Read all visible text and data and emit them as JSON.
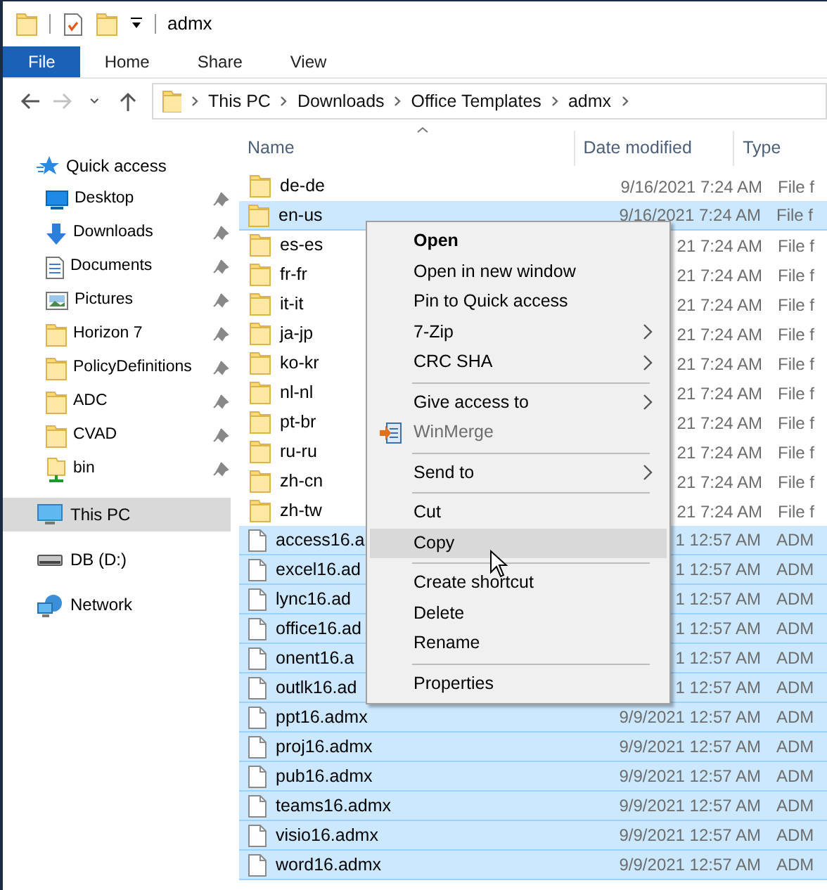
{
  "window": {
    "title": "admx"
  },
  "ribbon_tabs": [
    {
      "label": "File",
      "selected": true
    },
    {
      "label": "Home",
      "selected": false
    },
    {
      "label": "Share",
      "selected": false
    },
    {
      "label": "View",
      "selected": false
    }
  ],
  "navigation": [
    {
      "kind": "back",
      "disabled": false
    },
    {
      "kind": "forward",
      "disabled": true
    },
    {
      "kind": "recent",
      "disabled": false
    },
    {
      "kind": "up",
      "disabled": false
    }
  ],
  "address_bar": {
    "segments": [
      "This PC",
      "Downloads",
      "Office Templates",
      "admx"
    ]
  },
  "sidebar": {
    "items": [
      {
        "label": "Quick access",
        "kind": "star",
        "selected": false,
        "children": [
          {
            "label": "Desktop",
            "kind": "desktop",
            "pinned": true,
            "selected": false
          },
          {
            "label": "Downloads",
            "kind": "download",
            "pinned": true,
            "selected": false
          },
          {
            "label": "Documents",
            "kind": "document",
            "pinned": true,
            "selected": false
          },
          {
            "label": "Pictures",
            "kind": "pictures",
            "pinned": true,
            "selected": false
          },
          {
            "label": "Horizon 7",
            "kind": "folder",
            "pinned": true,
            "selected": false
          },
          {
            "label": "PolicyDefinitions",
            "kind": "folder",
            "pinned": true,
            "selected": false
          },
          {
            "label": "ADC",
            "kind": "folder",
            "pinned": true,
            "selected": false
          },
          {
            "label": "CVAD",
            "kind": "folder",
            "pinned": true,
            "selected": false
          },
          {
            "label": "bin",
            "kind": "share-folder",
            "pinned": true,
            "selected": false
          }
        ]
      },
      {
        "label": "This PC",
        "kind": "computer",
        "selected": true
      },
      {
        "label": "DB (D:)",
        "kind": "drive",
        "selected": false
      },
      {
        "label": "Network",
        "kind": "network",
        "selected": false
      }
    ]
  },
  "columns": [
    {
      "label": "Name",
      "sorted": true
    },
    {
      "label": "Date modified",
      "sorted": false
    },
    {
      "label": "Type",
      "sorted": false
    }
  ],
  "rows": [
    {
      "name": "de-de",
      "date": "9/16/2021 7:24 AM",
      "type": "File f",
      "kind": "folder",
      "selected": false
    },
    {
      "name": "en-us",
      "date": "9/16/2021 7:24 AM",
      "type": "File f",
      "kind": "folder",
      "selected": true
    },
    {
      "name": "es-es",
      "date": "21 7:24 AM",
      "type": "File f",
      "kind": "folder",
      "selected": false
    },
    {
      "name": "fr-fr",
      "date": "21 7:24 AM",
      "type": "File f",
      "kind": "folder",
      "selected": false
    },
    {
      "name": "it-it",
      "date": "21 7:24 AM",
      "type": "File f",
      "kind": "folder",
      "selected": false
    },
    {
      "name": "ja-jp",
      "date": "21 7:24 AM",
      "type": "File f",
      "kind": "folder",
      "selected": false
    },
    {
      "name": "ko-kr",
      "date": "21 7:24 AM",
      "type": "File f",
      "kind": "folder",
      "selected": false
    },
    {
      "name": "nl-nl",
      "date": "21 7:24 AM",
      "type": "File f",
      "kind": "folder",
      "selected": false
    },
    {
      "name": "pt-br",
      "date": "21 7:24 AM",
      "type": "File f",
      "kind": "folder",
      "selected": false
    },
    {
      "name": "ru-ru",
      "date": "21 7:24 AM",
      "type": "File f",
      "kind": "folder",
      "selected": false
    },
    {
      "name": "zh-cn",
      "date": "21 7:24 AM",
      "type": "File f",
      "kind": "folder",
      "selected": false
    },
    {
      "name": "zh-tw",
      "date": "21 7:24 AM",
      "type": "File f",
      "kind": "folder",
      "selected": false
    },
    {
      "name": "access16.a",
      "date": "1 12:57 AM",
      "type": "ADM",
      "kind": "file",
      "selected": true
    },
    {
      "name": "excel16.ad",
      "date": "1 12:57 AM",
      "type": "ADM",
      "kind": "file",
      "selected": true
    },
    {
      "name": "lync16.ad",
      "date": "1 12:57 AM",
      "type": "ADM",
      "kind": "file",
      "selected": true
    },
    {
      "name": "office16.ad",
      "date": "1 12:57 AM",
      "type": "ADM",
      "kind": "file",
      "selected": true
    },
    {
      "name": "onent16.a",
      "date": "1 12:57 AM",
      "type": "ADM",
      "kind": "file",
      "selected": true
    },
    {
      "name": "outlk16.ad",
      "date": "1 12:57 AM",
      "type": "ADM",
      "kind": "file",
      "selected": true
    },
    {
      "name": "ppt16.admx",
      "date": "9/9/2021 12:57 AM",
      "type": "ADM",
      "kind": "file",
      "selected": true
    },
    {
      "name": "proj16.admx",
      "date": "9/9/2021 12:57 AM",
      "type": "ADM",
      "kind": "file",
      "selected": true
    },
    {
      "name": "pub16.admx",
      "date": "9/9/2021 12:57 AM",
      "type": "ADM",
      "kind": "file",
      "selected": true
    },
    {
      "name": "teams16.admx",
      "date": "9/9/2021 12:57 AM",
      "type": "ADM",
      "kind": "file",
      "selected": true
    },
    {
      "name": "visio16.admx",
      "date": "9/9/2021 12:57 AM",
      "type": "ADM",
      "kind": "file",
      "selected": true
    },
    {
      "name": "word16.admx",
      "date": "9/9/2021 12:57 AM",
      "type": "ADM",
      "kind": "file",
      "selected": true
    }
  ],
  "context_menu": {
    "items": [
      {
        "kind": "item",
        "label": "Open",
        "bold": true,
        "submenu": false,
        "disabled": false,
        "selected": false
      },
      {
        "kind": "item",
        "label": "Open in new window",
        "bold": false,
        "submenu": false,
        "disabled": false,
        "selected": false
      },
      {
        "kind": "item",
        "label": "Pin to Quick access",
        "bold": false,
        "submenu": false,
        "disabled": false,
        "selected": false
      },
      {
        "kind": "item",
        "label": "7-Zip",
        "bold": false,
        "submenu": true,
        "disabled": false,
        "selected": false
      },
      {
        "kind": "item",
        "label": "CRC SHA",
        "bold": false,
        "submenu": true,
        "disabled": false,
        "selected": false
      },
      {
        "kind": "separator"
      },
      {
        "kind": "item",
        "label": "Give access to",
        "bold": false,
        "submenu": true,
        "disabled": false,
        "selected": false
      },
      {
        "kind": "item",
        "label": "WinMerge",
        "bold": false,
        "submenu": false,
        "disabled": true,
        "selected": false,
        "icon": true
      },
      {
        "kind": "separator"
      },
      {
        "kind": "item",
        "label": "Send to",
        "bold": false,
        "submenu": true,
        "disabled": false,
        "selected": false
      },
      {
        "kind": "separator"
      },
      {
        "kind": "item",
        "label": "Cut",
        "bold": false,
        "submenu": false,
        "disabled": false,
        "selected": false
      },
      {
        "kind": "item",
        "label": "Copy",
        "bold": false,
        "submenu": false,
        "disabled": false,
        "selected": true
      },
      {
        "kind": "separator"
      },
      {
        "kind": "item",
        "label": "Create shortcut",
        "bold": false,
        "submenu": false,
        "disabled": false,
        "selected": false
      },
      {
        "kind": "item",
        "label": "Delete",
        "bold": false,
        "submenu": false,
        "disabled": false,
        "selected": false
      },
      {
        "kind": "item",
        "label": "Rename",
        "bold": false,
        "submenu": false,
        "disabled": false,
        "selected": false
      },
      {
        "kind": "separator"
      },
      {
        "kind": "item",
        "label": "Properties",
        "bold": false,
        "submenu": false,
        "disabled": false,
        "selected": false
      }
    ]
  }
}
